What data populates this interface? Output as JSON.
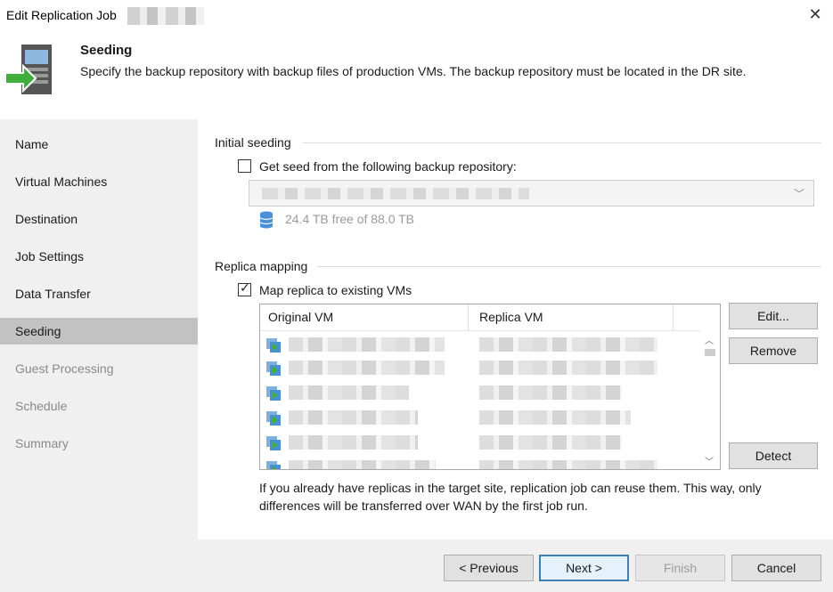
{
  "window": {
    "title": "Edit Replication Job"
  },
  "header": {
    "title": "Seeding",
    "description": "Specify the backup repository with backup files of production VMs. The backup repository must be located in the DR site."
  },
  "sidebar": {
    "items": [
      {
        "label": "Name",
        "state": "normal"
      },
      {
        "label": "Virtual Machines",
        "state": "normal"
      },
      {
        "label": "Destination",
        "state": "normal"
      },
      {
        "label": "Job Settings",
        "state": "normal"
      },
      {
        "label": "Data Transfer",
        "state": "normal"
      },
      {
        "label": "Seeding",
        "state": "active"
      },
      {
        "label": "Guest Processing",
        "state": "disabled"
      },
      {
        "label": "Schedule",
        "state": "disabled"
      },
      {
        "label": "Summary",
        "state": "disabled"
      }
    ]
  },
  "initial_seeding": {
    "group_label": "Initial seeding",
    "checkbox_label": "Get seed from the following backup repository:",
    "checked": false,
    "free_space": "24.4 TB free of 88.0 TB"
  },
  "replica_mapping": {
    "group_label": "Replica mapping",
    "checkbox_label": "Map replica to existing VMs",
    "checked": true,
    "columns": [
      "Original VM",
      "Replica VM"
    ],
    "row_count": 6,
    "buttons": {
      "edit": "Edit...",
      "remove": "Remove",
      "detect": "Detect"
    },
    "info": "If you already have replicas in the target site, replication job can reuse them. This way, only differences will be transferred over WAN by the first job run."
  },
  "footer": {
    "previous": "< Previous",
    "next": "Next >",
    "finish": "Finish",
    "cancel": "Cancel"
  },
  "colors": {
    "accent": "#3c7fb1",
    "sidebar_active": "#c2c2c2",
    "vm_arrow": "#3fae3f"
  }
}
